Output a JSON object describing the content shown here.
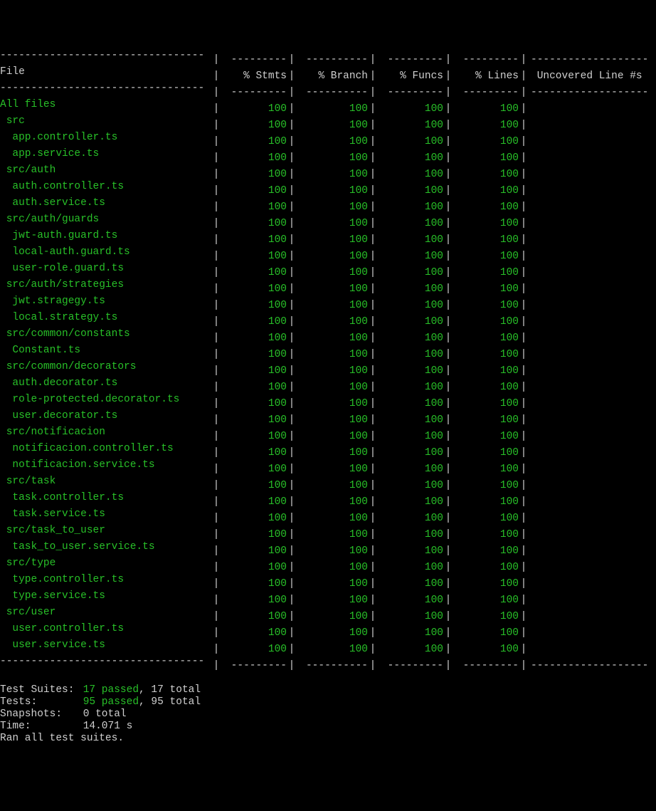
{
  "header": {
    "file": "File",
    "stmts": "% Stmts",
    "branch": "% Branch",
    "funcs": "% Funcs",
    "lines": "% Lines",
    "uncov": "Uncovered Line #s"
  },
  "rows": [
    {
      "indent": 0,
      "name": "All files",
      "stmts": "100",
      "branch": "100",
      "funcs": "100",
      "lines": "100",
      "uncov": ""
    },
    {
      "indent": 1,
      "name": "src",
      "stmts": "100",
      "branch": "100",
      "funcs": "100",
      "lines": "100",
      "uncov": ""
    },
    {
      "indent": 2,
      "name": "app.controller.ts",
      "stmts": "100",
      "branch": "100",
      "funcs": "100",
      "lines": "100",
      "uncov": ""
    },
    {
      "indent": 2,
      "name": "app.service.ts",
      "stmts": "100",
      "branch": "100",
      "funcs": "100",
      "lines": "100",
      "uncov": ""
    },
    {
      "indent": 1,
      "name": "src/auth",
      "stmts": "100",
      "branch": "100",
      "funcs": "100",
      "lines": "100",
      "uncov": ""
    },
    {
      "indent": 2,
      "name": "auth.controller.ts",
      "stmts": "100",
      "branch": "100",
      "funcs": "100",
      "lines": "100",
      "uncov": ""
    },
    {
      "indent": 2,
      "name": "auth.service.ts",
      "stmts": "100",
      "branch": "100",
      "funcs": "100",
      "lines": "100",
      "uncov": ""
    },
    {
      "indent": 1,
      "name": "src/auth/guards",
      "stmts": "100",
      "branch": "100",
      "funcs": "100",
      "lines": "100",
      "uncov": ""
    },
    {
      "indent": 2,
      "name": "jwt-auth.guard.ts",
      "stmts": "100",
      "branch": "100",
      "funcs": "100",
      "lines": "100",
      "uncov": ""
    },
    {
      "indent": 2,
      "name": "local-auth.guard.ts",
      "stmts": "100",
      "branch": "100",
      "funcs": "100",
      "lines": "100",
      "uncov": ""
    },
    {
      "indent": 2,
      "name": "user-role.guard.ts",
      "stmts": "100",
      "branch": "100",
      "funcs": "100",
      "lines": "100",
      "uncov": ""
    },
    {
      "indent": 1,
      "name": "src/auth/strategies",
      "stmts": "100",
      "branch": "100",
      "funcs": "100",
      "lines": "100",
      "uncov": ""
    },
    {
      "indent": 2,
      "name": "jwt.stragegy.ts",
      "stmts": "100",
      "branch": "100",
      "funcs": "100",
      "lines": "100",
      "uncov": ""
    },
    {
      "indent": 2,
      "name": "local.strategy.ts",
      "stmts": "100",
      "branch": "100",
      "funcs": "100",
      "lines": "100",
      "uncov": ""
    },
    {
      "indent": 1,
      "name": "src/common/constants",
      "stmts": "100",
      "branch": "100",
      "funcs": "100",
      "lines": "100",
      "uncov": ""
    },
    {
      "indent": 2,
      "name": "Constant.ts",
      "stmts": "100",
      "branch": "100",
      "funcs": "100",
      "lines": "100",
      "uncov": ""
    },
    {
      "indent": 1,
      "name": "src/common/decorators",
      "stmts": "100",
      "branch": "100",
      "funcs": "100",
      "lines": "100",
      "uncov": ""
    },
    {
      "indent": 2,
      "name": "auth.decorator.ts",
      "stmts": "100",
      "branch": "100",
      "funcs": "100",
      "lines": "100",
      "uncov": ""
    },
    {
      "indent": 2,
      "name": "role-protected.decorator.ts",
      "stmts": "100",
      "branch": "100",
      "funcs": "100",
      "lines": "100",
      "uncov": ""
    },
    {
      "indent": 2,
      "name": "user.decorator.ts",
      "stmts": "100",
      "branch": "100",
      "funcs": "100",
      "lines": "100",
      "uncov": ""
    },
    {
      "indent": 1,
      "name": "src/notificacion",
      "stmts": "100",
      "branch": "100",
      "funcs": "100",
      "lines": "100",
      "uncov": ""
    },
    {
      "indent": 2,
      "name": "notificacion.controller.ts",
      "stmts": "100",
      "branch": "100",
      "funcs": "100",
      "lines": "100",
      "uncov": ""
    },
    {
      "indent": 2,
      "name": "notificacion.service.ts",
      "stmts": "100",
      "branch": "100",
      "funcs": "100",
      "lines": "100",
      "uncov": ""
    },
    {
      "indent": 1,
      "name": "src/task",
      "stmts": "100",
      "branch": "100",
      "funcs": "100",
      "lines": "100",
      "uncov": ""
    },
    {
      "indent": 2,
      "name": "task.controller.ts",
      "stmts": "100",
      "branch": "100",
      "funcs": "100",
      "lines": "100",
      "uncov": ""
    },
    {
      "indent": 2,
      "name": "task.service.ts",
      "stmts": "100",
      "branch": "100",
      "funcs": "100",
      "lines": "100",
      "uncov": ""
    },
    {
      "indent": 1,
      "name": "src/task_to_user",
      "stmts": "100",
      "branch": "100",
      "funcs": "100",
      "lines": "100",
      "uncov": ""
    },
    {
      "indent": 2,
      "name": "task_to_user.service.ts",
      "stmts": "100",
      "branch": "100",
      "funcs": "100",
      "lines": "100",
      "uncov": ""
    },
    {
      "indent": 1,
      "name": "src/type",
      "stmts": "100",
      "branch": "100",
      "funcs": "100",
      "lines": "100",
      "uncov": ""
    },
    {
      "indent": 2,
      "name": "type.controller.ts",
      "stmts": "100",
      "branch": "100",
      "funcs": "100",
      "lines": "100",
      "uncov": ""
    },
    {
      "indent": 2,
      "name": "type.service.ts",
      "stmts": "100",
      "branch": "100",
      "funcs": "100",
      "lines": "100",
      "uncov": ""
    },
    {
      "indent": 1,
      "name": "src/user",
      "stmts": "100",
      "branch": "100",
      "funcs": "100",
      "lines": "100",
      "uncov": ""
    },
    {
      "indent": 2,
      "name": "user.controller.ts",
      "stmts": "100",
      "branch": "100",
      "funcs": "100",
      "lines": "100",
      "uncov": ""
    },
    {
      "indent": 2,
      "name": "user.service.ts",
      "stmts": "100",
      "branch": "100",
      "funcs": "100",
      "lines": "100",
      "uncov": ""
    }
  ],
  "dash": {
    "file": "---------------------------------",
    "stmts": "---------",
    "branch": "----------",
    "funcs": "---------",
    "lines": "---------",
    "uncov": "-------------------"
  },
  "summary": {
    "testSuites": {
      "label": "Test Suites:",
      "passed": "17 passed",
      "rest": ", 17 total"
    },
    "tests": {
      "label": "Tests:",
      "passed": "95 passed",
      "rest": ", 95 total"
    },
    "snapshots": {
      "label": "Snapshots:",
      "value": "0 total"
    },
    "time": {
      "label": "Time:",
      "value": "14.071 s"
    },
    "footer": "Ran all test suites."
  }
}
